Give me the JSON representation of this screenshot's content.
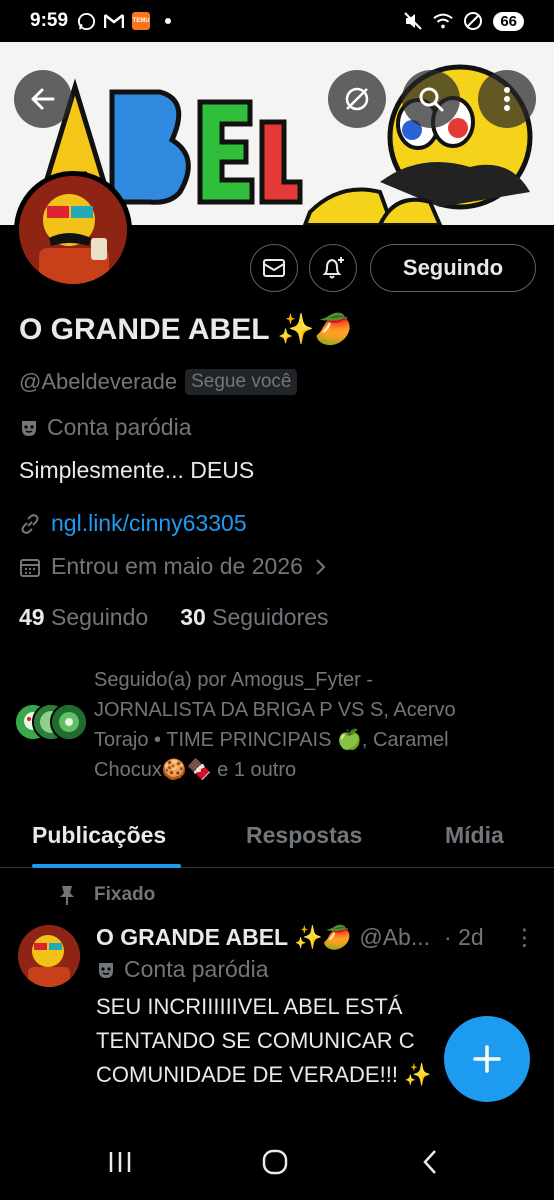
{
  "status_bar": {
    "time": "9:59",
    "battery": "66",
    "icons": [
      "whatsapp-icon",
      "gmail-icon",
      "temu-icon",
      "dot-icon",
      "mute-icon",
      "wifi-icon",
      "no-disturb-icon",
      "battery-icon"
    ]
  },
  "banner": {
    "art_text": "ABEL",
    "buttons": [
      "back-icon",
      "translate-icon",
      "search-icon",
      "more-vertical-icon"
    ]
  },
  "profile": {
    "display_name": "O GRANDE ABEL ✨🥭",
    "handle": "@Abeldeverade",
    "follows_you_badge": "Segue você",
    "label": "Conta paródia",
    "bio": "Simplesmente... DEUS",
    "link": "ngl.link/cinny63305",
    "joined": "Entrou em maio de 2026",
    "following_count": "49",
    "following_label": "Seguindo",
    "followers_count": "30",
    "followers_label": "Seguidores",
    "followed_by": "Seguido(a) por Amogus_Fyter - JORNALISTA DA BRIGA P VS S, Acervo Torajo • TIME PRINCIPAIS 🍏, Caramel Chocux🍪🍫 e 1 outro"
  },
  "actions": {
    "follow_button": "Seguindo"
  },
  "tabs": [
    {
      "label": "Publicações",
      "active": true
    },
    {
      "label": "Respostas",
      "active": false
    },
    {
      "label": "Mídia",
      "active": false
    }
  ],
  "pinned_post": {
    "pinned_label": "Fixado",
    "author_name": "O GRANDE ABEL ✨🥭",
    "author_handle": "@Ab...",
    "time": "· 2d",
    "more": "⋮",
    "author_label": "Conta paródia",
    "text": "SEU INCRIIIIIIVEL ABEL ESTÁ\nTENTANDO SE COMUNICAR C\nCOMUNIDADE DE VERADE!!! ✨"
  },
  "colors": {
    "accent": "#1d9bf0",
    "background": "#000000",
    "text_primary": "#e7e9ea",
    "text_secondary": "#71767b",
    "border": "#2f3336"
  }
}
